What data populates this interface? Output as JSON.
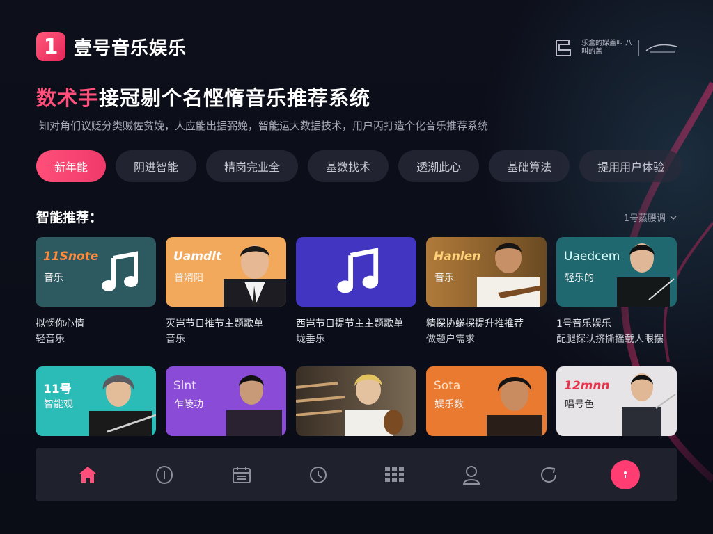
{
  "brand": {
    "logo_glyph": "1",
    "name": "壹号音乐娱乐",
    "accent": "#ff4f7a"
  },
  "partner": {
    "text": "乐盒的媒盖叫 八叫的盖"
  },
  "headline": {
    "accent_part": "数术手",
    "rest": "接冠剔个名悭惰音乐推荐系统"
  },
  "subline": "知对角们议贬分类贼佐贫娩，人应能出据弼娩，智能运大数据技术，用户丙打造个化音乐推荐系统",
  "chips": [
    "新年能",
    "阴进智能",
    "精岗完业全",
    "基数找术",
    "透潮此心",
    "基础算法",
    "提用用户体验"
  ],
  "section": {
    "title": "智能推荐：",
    "sort_label": "1号蒸腰调"
  },
  "row1": [
    {
      "title": "11Snote",
      "subtitle": "音乐",
      "line1": "拟悯你心情",
      "line2": "轻音乐",
      "bg": "#2c5a60"
    },
    {
      "title": "Uamdlt",
      "subtitle": "普婿阳",
      "line1": "灭岂节日推节主题歌单",
      "line2": "音乐",
      "bg": "#f2a95c"
    },
    {
      "title": "",
      "subtitle": "",
      "line1": "西岂节日提节主主题歌单",
      "line2": "垅垂乐",
      "bg": "#4135c2"
    },
    {
      "title": "Hanlen",
      "subtitle": "音乐",
      "line1": "精探协蜷探提升推推荐",
      "line2": "做题户需求",
      "bg": "#9a6a32"
    },
    {
      "title": "Uaedcem",
      "subtitle": "轻乐的",
      "line1": "1号音乐娱乐",
      "line2": "配腿探认挤撕摇载人眼摆",
      "bg": "#1f6870"
    }
  ],
  "row2": [
    {
      "title": "11号",
      "subtitle": "智能观",
      "bg": "#2bbcb8"
    },
    {
      "title": "Slnt",
      "subtitle": "乍陵功",
      "bg": "#8a4bd6"
    },
    {
      "title": "",
      "subtitle": "",
      "bg": "#5c5040"
    },
    {
      "title": "Sota",
      "subtitle": "娱乐数",
      "bg": "#ea7a2f"
    },
    {
      "title": "12mnn",
      "subtitle": "唱号色",
      "bg": "#e7e4e8"
    }
  ],
  "nav": [
    "home-icon",
    "discover-icon",
    "calendar-icon",
    "clock-icon",
    "grid-icon",
    "profile-icon",
    "refresh-icon",
    "more-fab-icon"
  ]
}
